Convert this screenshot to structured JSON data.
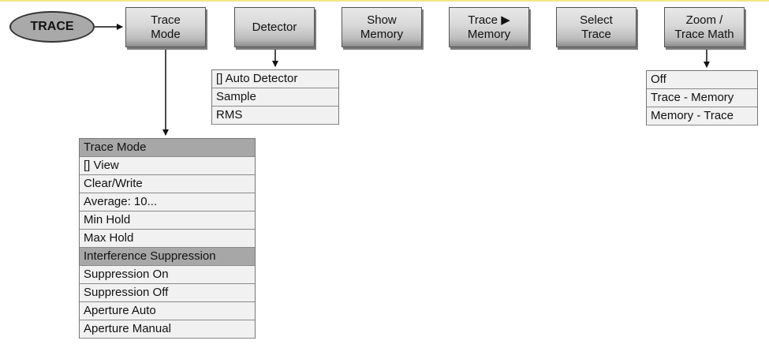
{
  "root": {
    "label": "TRACE"
  },
  "softkeys": [
    {
      "id": "trace-mode",
      "label": "Trace\nMode"
    },
    {
      "id": "detector",
      "label": "Detector"
    },
    {
      "id": "show-memory",
      "label": "Show\nMemory"
    },
    {
      "id": "trace-to-memory",
      "label": "Trace ▶\nMemory"
    },
    {
      "id": "select-trace",
      "label": "Select\nTrace"
    },
    {
      "id": "zoom-trace-math",
      "label": "Zoom /\nTrace Math"
    }
  ],
  "detector_menu": {
    "items": [
      "[] Auto Detector",
      "Sample",
      "RMS"
    ]
  },
  "zoom_menu": {
    "items": [
      "Off",
      "Trace - Memory",
      "Memory - Trace"
    ]
  },
  "trace_mode_menu": {
    "header": "Trace Mode",
    "items": [
      "[] View",
      "Clear/Write",
      "Average: 10...",
      "Min Hold",
      "Max Hold"
    ],
    "section_header": "Interference Suppression",
    "section_items": [
      "Suppression On",
      "Suppression Off",
      "Aperture Auto",
      "Aperture Manual"
    ]
  }
}
